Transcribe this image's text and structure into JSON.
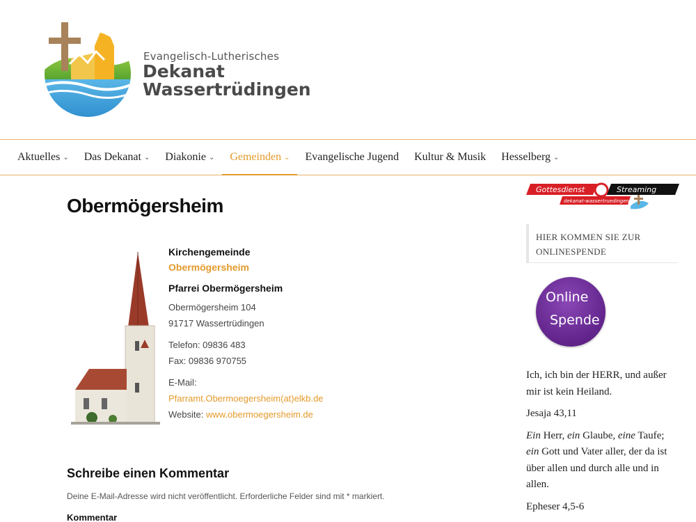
{
  "header": {
    "logo_sub": "Evangelisch-Lutherisches",
    "logo_line1": "Dekanat",
    "logo_line2": "Wassertrüdingen"
  },
  "nav": {
    "items": [
      {
        "label": "Aktuelles",
        "has_dropdown": true
      },
      {
        "label": "Das Dekanat",
        "has_dropdown": true
      },
      {
        "label": "Diakonie",
        "has_dropdown": true
      },
      {
        "label": "Gemeinden",
        "has_dropdown": true,
        "active": true
      },
      {
        "label": "Evangelische Jugend",
        "has_dropdown": false
      },
      {
        "label": "Kultur & Musik",
        "has_dropdown": false
      },
      {
        "label": "Hesselberg",
        "has_dropdown": true
      }
    ]
  },
  "main": {
    "title": "Obermögersheim",
    "info": {
      "heading": "Kirchengemeinde",
      "heading_link": "Obermögersheim",
      "parish": "Pfarrei Obermögersheim",
      "address1": "Obermögersheim 104",
      "address2": "91717 Wassertrüdingen",
      "phone": "Telefon: 09836 483",
      "fax": "Fax: 09836 970755",
      "email_label": "E-Mail:",
      "email": "Pfarramt.Obermoegersheim(at)elkb.de",
      "website_label": "Website:",
      "website": "www.obermoegersheim.de"
    },
    "comment": {
      "title": "Schreibe einen Kommentar",
      "note": "Deine E-Mail-Adresse wird nicht veröffentlicht. Erforderliche Felder sind mit * markiert.",
      "label": "Kommentar"
    }
  },
  "sidebar": {
    "stream_text1": "Gottesdienst",
    "stream_text2": "Streaming",
    "stream_url": "dekanat-wassertruedingen.de",
    "donate_text": "HIER KOMMEN SIE ZUR ONLINESPENDE",
    "donate_circle1": "Online",
    "donate_circle2": "Spende",
    "verse1": "Ich, ich bin der HERR, und außer mir ist kein Heiland.",
    "ref1": "Jesaja 43,11",
    "verse2_parts": [
      "Ein",
      " Herr, ",
      "ein",
      " Glaube, ",
      "eine",
      " Taufe; ",
      "ein",
      " Gott und Vater aller, der da ist über allen und durch alle und in allen."
    ],
    "ref2": "Epheser 4,5-6"
  },
  "colors": {
    "accent": "#e39a2b",
    "donate_purple": "#64268e"
  }
}
